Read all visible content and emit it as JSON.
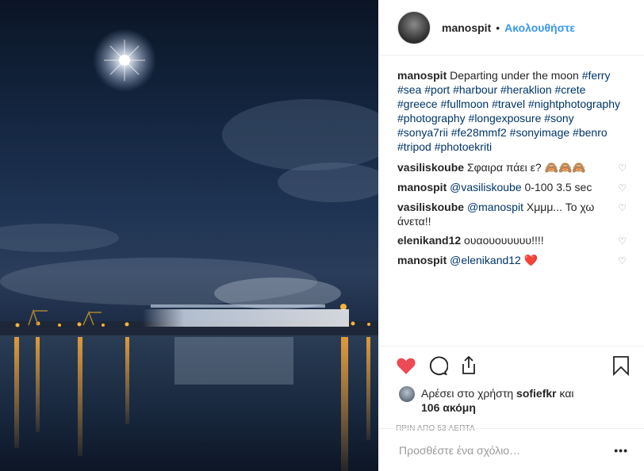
{
  "header": {
    "username": "manospit",
    "separator": "•",
    "follow_label": "Ακολουθήστε"
  },
  "caption": {
    "username": "manospit",
    "text": "Departing under the moon",
    "tags": [
      "#ferry",
      "#sea",
      "#port",
      "#harbour",
      "#heraklion",
      "#crete",
      "#greece",
      "#fullmoon",
      "#travel",
      "#nightphotography",
      "#photography",
      "#longexposure",
      "#sony",
      "#sonya7rii",
      "#fe28mmf2",
      "#sonyimage",
      "#benro",
      "#tripod",
      "#photoekriti"
    ]
  },
  "comments": [
    {
      "user": "vasiliskoube",
      "text": "Σφαιρα πάει ε? 🙈🙈🙈"
    },
    {
      "user": "manospit",
      "mention": "@vasiliskoube",
      "text": "0-100 3.5 sec"
    },
    {
      "user": "vasiliskoube",
      "mention": "@manospit",
      "text": "Χμμμ... Το χω άνετα!!"
    },
    {
      "user": "elenikand12",
      "text": "ουαουουυυυυ!!!!"
    },
    {
      "user": "manospit",
      "mention": "@elenikand12",
      "text": "❤️"
    }
  ],
  "likes": {
    "prefix": "Αρέσει στο χρήστη",
    "user": "sofiefkr",
    "joiner": "και",
    "count": "106 ακόμη"
  },
  "timestamp": "ΠΡΙΝ ΑΠΟ 53 ΛΕΠΤΑ",
  "add_comment": {
    "placeholder": "Προσθέστε ένα σχόλιο…",
    "more": "•••"
  },
  "icons": {
    "like": "heart-filled-icon",
    "comment": "comment-icon",
    "share": "share-icon",
    "save": "bookmark-icon"
  },
  "colors": {
    "like_red": "#ed4956",
    "follow_blue": "#3897f0",
    "tag_blue": "#003569"
  }
}
